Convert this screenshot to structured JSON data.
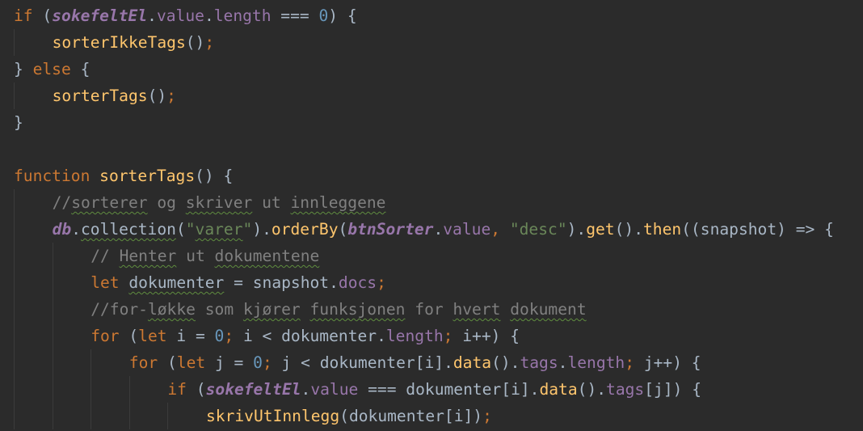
{
  "colors": {
    "background": "#2b2b2b",
    "plain": "#a9b7c6",
    "keyword": "#cc7832",
    "function": "#ffc66d",
    "property": "#9876aa",
    "number": "#6897bb",
    "string": "#6a8759",
    "comment": "#808080",
    "spellcheck_underline": "#5f8c3f"
  },
  "code": {
    "lines": [
      {
        "indent": 0,
        "tokens": [
          {
            "t": "if",
            "c": "keyword"
          },
          {
            "t": " (",
            "c": "plain"
          },
          {
            "t": "sokefeltEl",
            "c": "param-italic"
          },
          {
            "t": ".",
            "c": "plain"
          },
          {
            "t": "value",
            "c": "prop"
          },
          {
            "t": ".",
            "c": "plain"
          },
          {
            "t": "length",
            "c": "prop"
          },
          {
            "t": " === ",
            "c": "plain"
          },
          {
            "t": "0",
            "c": "num"
          },
          {
            "t": ") {",
            "c": "plain"
          }
        ]
      },
      {
        "indent": 1,
        "tokens": [
          {
            "t": "sorterIkkeTags",
            "c": "fn"
          },
          {
            "t": "()",
            "c": "plain"
          },
          {
            "t": ";",
            "c": "keyword"
          }
        ]
      },
      {
        "indent": 0,
        "tokens": [
          {
            "t": "} ",
            "c": "plain"
          },
          {
            "t": "else",
            "c": "keyword"
          },
          {
            "t": " {",
            "c": "plain"
          }
        ]
      },
      {
        "indent": 1,
        "tokens": [
          {
            "t": "sorterTags",
            "c": "fn"
          },
          {
            "t": "()",
            "c": "plain"
          },
          {
            "t": ";",
            "c": "keyword"
          }
        ]
      },
      {
        "indent": 0,
        "tokens": [
          {
            "t": "}",
            "c": "plain"
          }
        ]
      },
      {
        "indent": 0,
        "tokens": []
      },
      {
        "indent": 0,
        "tokens": [
          {
            "t": "function",
            "c": "keyword"
          },
          {
            "t": " ",
            "c": "plain"
          },
          {
            "t": "sorterTags",
            "c": "fn"
          },
          {
            "t": "() {",
            "c": "plain"
          }
        ]
      },
      {
        "indent": 1,
        "tokens": [
          {
            "t": "//",
            "c": "comment"
          },
          {
            "t": "sorterer",
            "c": "comment",
            "s": 1
          },
          {
            "t": " og ",
            "c": "comment"
          },
          {
            "t": "skriver",
            "c": "comment",
            "s": 1
          },
          {
            "t": " ut ",
            "c": "comment"
          },
          {
            "t": "innleggene",
            "c": "comment",
            "s": 1
          }
        ]
      },
      {
        "indent": 1,
        "tokens": [
          {
            "t": "db",
            "c": "param-italic"
          },
          {
            "t": ".",
            "c": "plain"
          },
          {
            "t": "collection",
            "c": "plain",
            "s": 1
          },
          {
            "t": "(",
            "c": "plain"
          },
          {
            "t": "\"",
            "c": "str"
          },
          {
            "t": "varer",
            "c": "str",
            "s": 1
          },
          {
            "t": "\"",
            "c": "str"
          },
          {
            "t": ").",
            "c": "plain"
          },
          {
            "t": "orderBy",
            "c": "fn"
          },
          {
            "t": "(",
            "c": "plain"
          },
          {
            "t": "btnSorter",
            "c": "param-italic"
          },
          {
            "t": ".",
            "c": "plain"
          },
          {
            "t": "value",
            "c": "prop"
          },
          {
            "t": ", ",
            "c": "keyword"
          },
          {
            "t": "\"desc\"",
            "c": "str"
          },
          {
            "t": ").",
            "c": "plain"
          },
          {
            "t": "get",
            "c": "fn"
          },
          {
            "t": "().",
            "c": "plain"
          },
          {
            "t": "then",
            "c": "fn"
          },
          {
            "t": "((snapshot) => {",
            "c": "plain"
          }
        ]
      },
      {
        "indent": 2,
        "tokens": [
          {
            "t": "// ",
            "c": "comment"
          },
          {
            "t": "Henter",
            "c": "comment",
            "s": 1
          },
          {
            "t": " ut ",
            "c": "comment"
          },
          {
            "t": "dokumentene",
            "c": "comment",
            "s": 1
          }
        ]
      },
      {
        "indent": 2,
        "tokens": [
          {
            "t": "let",
            "c": "keyword"
          },
          {
            "t": " ",
            "c": "plain"
          },
          {
            "t": "dokumenter",
            "c": "plain",
            "s": 1
          },
          {
            "t": " = snapshot.",
            "c": "plain"
          },
          {
            "t": "docs",
            "c": "prop"
          },
          {
            "t": ";",
            "c": "keyword"
          }
        ]
      },
      {
        "indent": 2,
        "tokens": [
          {
            "t": "//for-",
            "c": "comment"
          },
          {
            "t": "løkke",
            "c": "comment",
            "s": 1
          },
          {
            "t": " som ",
            "c": "comment"
          },
          {
            "t": "kjører",
            "c": "comment",
            "s": 1
          },
          {
            "t": " ",
            "c": "comment"
          },
          {
            "t": "funksjonen",
            "c": "comment",
            "s": 1
          },
          {
            "t": " for ",
            "c": "comment"
          },
          {
            "t": "hvert",
            "c": "comment",
            "s": 1
          },
          {
            "t": " ",
            "c": "comment"
          },
          {
            "t": "dokument",
            "c": "comment",
            "s": 1
          }
        ]
      },
      {
        "indent": 2,
        "tokens": [
          {
            "t": "for",
            "c": "keyword"
          },
          {
            "t": " (",
            "c": "plain"
          },
          {
            "t": "let",
            "c": "keyword"
          },
          {
            "t": " i = ",
            "c": "plain"
          },
          {
            "t": "0",
            "c": "num"
          },
          {
            "t": "; ",
            "c": "keyword"
          },
          {
            "t": "i < dokumenter.",
            "c": "plain"
          },
          {
            "t": "length",
            "c": "prop"
          },
          {
            "t": "; ",
            "c": "keyword"
          },
          {
            "t": "i++) {",
            "c": "plain"
          }
        ]
      },
      {
        "indent": 3,
        "tokens": [
          {
            "t": "for",
            "c": "keyword"
          },
          {
            "t": " (",
            "c": "plain"
          },
          {
            "t": "let",
            "c": "keyword"
          },
          {
            "t": " j = ",
            "c": "plain"
          },
          {
            "t": "0",
            "c": "num"
          },
          {
            "t": "; ",
            "c": "keyword"
          },
          {
            "t": "j < dokumenter[i].",
            "c": "plain"
          },
          {
            "t": "data",
            "c": "fn"
          },
          {
            "t": "().",
            "c": "plain"
          },
          {
            "t": "tags",
            "c": "prop"
          },
          {
            "t": ".",
            "c": "plain"
          },
          {
            "t": "length",
            "c": "prop"
          },
          {
            "t": "; ",
            "c": "keyword"
          },
          {
            "t": "j++) {",
            "c": "plain"
          }
        ]
      },
      {
        "indent": 4,
        "tokens": [
          {
            "t": "if",
            "c": "keyword"
          },
          {
            "t": " (",
            "c": "plain"
          },
          {
            "t": "sokefeltEl",
            "c": "param-italic"
          },
          {
            "t": ".",
            "c": "plain"
          },
          {
            "t": "value",
            "c": "prop"
          },
          {
            "t": " === dokumenter[i].",
            "c": "plain"
          },
          {
            "t": "data",
            "c": "fn"
          },
          {
            "t": "().",
            "c": "plain"
          },
          {
            "t": "tags",
            "c": "prop"
          },
          {
            "t": "[j]) {",
            "c": "plain"
          }
        ]
      },
      {
        "indent": 5,
        "tokens": [
          {
            "t": "skrivUtInnlegg",
            "c": "fn"
          },
          {
            "t": "(dokumenter[i])",
            "c": "plain"
          },
          {
            "t": ";",
            "c": "keyword"
          }
        ]
      }
    ]
  }
}
